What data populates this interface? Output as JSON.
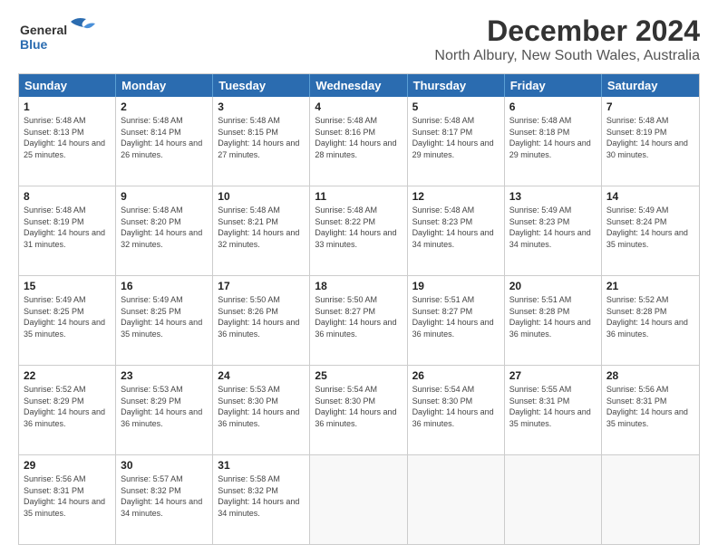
{
  "logo": {
    "line1": "General",
    "line2": "Blue"
  },
  "title": "December 2024",
  "subtitle": "North Albury, New South Wales, Australia",
  "weekdays": [
    "Sunday",
    "Monday",
    "Tuesday",
    "Wednesday",
    "Thursday",
    "Friday",
    "Saturday"
  ],
  "weeks": [
    [
      {
        "day": "1",
        "rise": "5:48 AM",
        "set": "8:13 PM",
        "daylight": "14 hours and 25 minutes."
      },
      {
        "day": "2",
        "rise": "5:48 AM",
        "set": "8:14 PM",
        "daylight": "14 hours and 26 minutes."
      },
      {
        "day": "3",
        "rise": "5:48 AM",
        "set": "8:15 PM",
        "daylight": "14 hours and 27 minutes."
      },
      {
        "day": "4",
        "rise": "5:48 AM",
        "set": "8:16 PM",
        "daylight": "14 hours and 28 minutes."
      },
      {
        "day": "5",
        "rise": "5:48 AM",
        "set": "8:17 PM",
        "daylight": "14 hours and 29 minutes."
      },
      {
        "day": "6",
        "rise": "5:48 AM",
        "set": "8:18 PM",
        "daylight": "14 hours and 29 minutes."
      },
      {
        "day": "7",
        "rise": "5:48 AM",
        "set": "8:19 PM",
        "daylight": "14 hours and 30 minutes."
      }
    ],
    [
      {
        "day": "8",
        "rise": "5:48 AM",
        "set": "8:19 PM",
        "daylight": "14 hours and 31 minutes."
      },
      {
        "day": "9",
        "rise": "5:48 AM",
        "set": "8:20 PM",
        "daylight": "14 hours and 32 minutes."
      },
      {
        "day": "10",
        "rise": "5:48 AM",
        "set": "8:21 PM",
        "daylight": "14 hours and 32 minutes."
      },
      {
        "day": "11",
        "rise": "5:48 AM",
        "set": "8:22 PM",
        "daylight": "14 hours and 33 minutes."
      },
      {
        "day": "12",
        "rise": "5:48 AM",
        "set": "8:23 PM",
        "daylight": "14 hours and 34 minutes."
      },
      {
        "day": "13",
        "rise": "5:49 AM",
        "set": "8:23 PM",
        "daylight": "14 hours and 34 minutes."
      },
      {
        "day": "14",
        "rise": "5:49 AM",
        "set": "8:24 PM",
        "daylight": "14 hours and 35 minutes."
      }
    ],
    [
      {
        "day": "15",
        "rise": "5:49 AM",
        "set": "8:25 PM",
        "daylight": "14 hours and 35 minutes."
      },
      {
        "day": "16",
        "rise": "5:49 AM",
        "set": "8:25 PM",
        "daylight": "14 hours and 35 minutes."
      },
      {
        "day": "17",
        "rise": "5:50 AM",
        "set": "8:26 PM",
        "daylight": "14 hours and 36 minutes."
      },
      {
        "day": "18",
        "rise": "5:50 AM",
        "set": "8:27 PM",
        "daylight": "14 hours and 36 minutes."
      },
      {
        "day": "19",
        "rise": "5:51 AM",
        "set": "8:27 PM",
        "daylight": "14 hours and 36 minutes."
      },
      {
        "day": "20",
        "rise": "5:51 AM",
        "set": "8:28 PM",
        "daylight": "14 hours and 36 minutes."
      },
      {
        "day": "21",
        "rise": "5:52 AM",
        "set": "8:28 PM",
        "daylight": "14 hours and 36 minutes."
      }
    ],
    [
      {
        "day": "22",
        "rise": "5:52 AM",
        "set": "8:29 PM",
        "daylight": "14 hours and 36 minutes."
      },
      {
        "day": "23",
        "rise": "5:53 AM",
        "set": "8:29 PM",
        "daylight": "14 hours and 36 minutes."
      },
      {
        "day": "24",
        "rise": "5:53 AM",
        "set": "8:30 PM",
        "daylight": "14 hours and 36 minutes."
      },
      {
        "day": "25",
        "rise": "5:54 AM",
        "set": "8:30 PM",
        "daylight": "14 hours and 36 minutes."
      },
      {
        "day": "26",
        "rise": "5:54 AM",
        "set": "8:30 PM",
        "daylight": "14 hours and 36 minutes."
      },
      {
        "day": "27",
        "rise": "5:55 AM",
        "set": "8:31 PM",
        "daylight": "14 hours and 35 minutes."
      },
      {
        "day": "28",
        "rise": "5:56 AM",
        "set": "8:31 PM",
        "daylight": "14 hours and 35 minutes."
      }
    ],
    [
      {
        "day": "29",
        "rise": "5:56 AM",
        "set": "8:31 PM",
        "daylight": "14 hours and 35 minutes."
      },
      {
        "day": "30",
        "rise": "5:57 AM",
        "set": "8:32 PM",
        "daylight": "14 hours and 34 minutes."
      },
      {
        "day": "31",
        "rise": "5:58 AM",
        "set": "8:32 PM",
        "daylight": "14 hours and 34 minutes."
      },
      null,
      null,
      null,
      null
    ]
  ]
}
